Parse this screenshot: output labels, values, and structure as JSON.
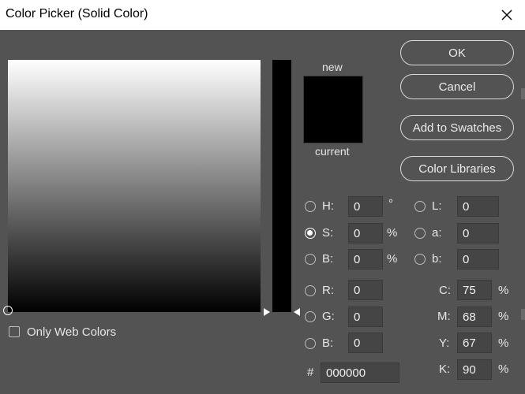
{
  "window": {
    "title": "Color Picker (Solid Color)"
  },
  "preview": {
    "new_label": "new",
    "current_label": "current",
    "new_color": "#000000",
    "current_color": "#000000"
  },
  "buttons": {
    "ok": "OK",
    "cancel": "Cancel",
    "add_to_swatches": "Add to Swatches",
    "color_libraries": "Color Libraries"
  },
  "hsb": {
    "h": {
      "label": "H:",
      "value": "0",
      "unit": "°"
    },
    "s": {
      "label": "S:",
      "value": "0",
      "unit": "%"
    },
    "b": {
      "label": "B:",
      "value": "0",
      "unit": "%"
    }
  },
  "lab": {
    "l": {
      "label": "L:",
      "value": "0"
    },
    "a": {
      "label": "a:",
      "value": "0"
    },
    "b": {
      "label": "b:",
      "value": "0"
    }
  },
  "rgb": {
    "r": {
      "label": "R:",
      "value": "0"
    },
    "g": {
      "label": "G:",
      "value": "0"
    },
    "b": {
      "label": "B:",
      "value": "0"
    }
  },
  "cmyk": {
    "c": {
      "label": "C:",
      "value": "75",
      "unit": "%"
    },
    "m": {
      "label": "M:",
      "value": "68",
      "unit": "%"
    },
    "y": {
      "label": "Y:",
      "value": "67",
      "unit": "%"
    },
    "k": {
      "label": "K:",
      "value": "90",
      "unit": "%"
    }
  },
  "hex": {
    "label": "#",
    "value": "000000"
  },
  "web_colors": {
    "label": "Only Web Colors",
    "checked": false
  },
  "selected_mode": "S",
  "colors": {
    "background": "#535353",
    "titlebar": "#ffffff"
  }
}
